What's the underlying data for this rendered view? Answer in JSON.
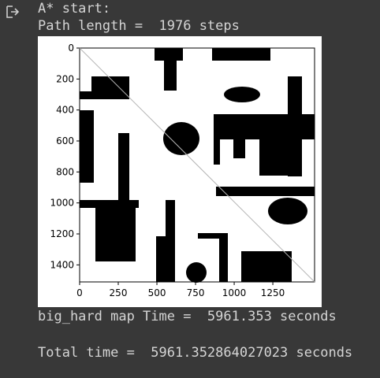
{
  "output_icon": "output-arrow-icon",
  "lines": {
    "header": "A* start:",
    "path_length": "Path length =  1976 steps",
    "map_time": "big_hard map Time =  5961.353 seconds",
    "total_time": "Total time =  5961.352864027023 seconds"
  },
  "plot": {
    "x_ticks": [
      "0",
      "250",
      "500",
      "750",
      "1000",
      "1250"
    ],
    "y_ticks": [
      "0",
      "200",
      "400",
      "600",
      "800",
      "1000",
      "1200",
      "1400"
    ],
    "xlim": [
      0,
      1520
    ],
    "ylim": [
      1510,
      0
    ],
    "path": [
      [
        0,
        0
      ],
      [
        1520,
        1510
      ]
    ]
  }
}
